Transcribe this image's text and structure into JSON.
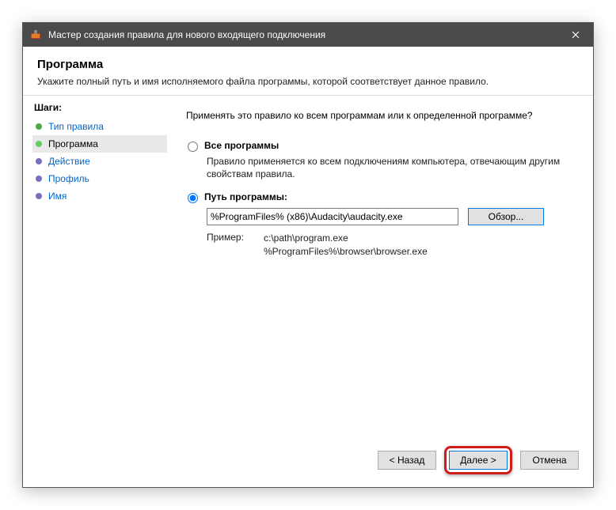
{
  "window": {
    "title": "Мастер создания правила для нового входящего подключения"
  },
  "header": {
    "title": "Программа",
    "subtitle": "Укажите полный путь и имя исполняемого файла программы, которой соответствует данное правило."
  },
  "steps": {
    "label": "Шаги:",
    "items": [
      {
        "label": "Тип правила",
        "color": "#4aa84a",
        "active": false
      },
      {
        "label": "Программа",
        "color": "#62d060",
        "active": true
      },
      {
        "label": "Действие",
        "color": "#7a6fbf",
        "active": false
      },
      {
        "label": "Профиль",
        "color": "#7a6fbf",
        "active": false
      },
      {
        "label": "Имя",
        "color": "#7a6fbf",
        "active": false
      }
    ]
  },
  "content": {
    "question": "Применять это правило ко всем программам или к определенной программе?",
    "option_all": {
      "label": "Все программы",
      "desc": "Правило применяется ко всем подключениям компьютера, отвечающим другим свойствам правила."
    },
    "option_path": {
      "label": "Путь программы:",
      "value": "%ProgramFiles% (x86)\\Audacity\\audacity.exe",
      "browse": "Обзор..."
    },
    "example": {
      "label": "Пример:",
      "paths": "c:\\path\\program.exe\n%ProgramFiles%\\browser\\browser.exe"
    }
  },
  "footer": {
    "back": "< Назад",
    "next": "Далее >",
    "cancel": "Отмена"
  }
}
